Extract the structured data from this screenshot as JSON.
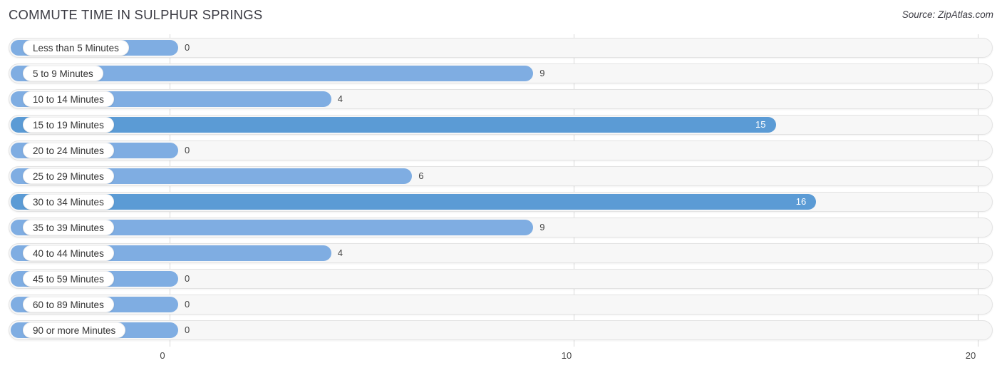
{
  "header": {
    "title": "COMMUTE TIME IN SULPHUR SPRINGS",
    "source": "Source: ZipAtlas.com"
  },
  "colors": {
    "bar_light": "#7fadE2",
    "bar_dark": "#5b9bd5",
    "track_bg": "#f7f7f7",
    "track_border": "#e3e3e3",
    "gridline": "#d8d8d8",
    "text": "#333333",
    "value_inside": "#ffffff"
  },
  "chart_data": {
    "type": "bar",
    "orientation": "horizontal",
    "title": "COMMUTE TIME IN SULPHUR SPRINGS",
    "xlabel": "",
    "ylabel": "",
    "xlim": [
      0,
      20
    ],
    "xticks": [
      0,
      10,
      20
    ],
    "xtick_labels": [
      "0",
      "10",
      "20"
    ],
    "grid": true,
    "legend": false,
    "categories": [
      "Less than 5 Minutes",
      "5 to 9 Minutes",
      "10 to 14 Minutes",
      "15 to 19 Minutes",
      "20 to 24 Minutes",
      "25 to 29 Minutes",
      "30 to 34 Minutes",
      "35 to 39 Minutes",
      "40 to 44 Minutes",
      "45 to 59 Minutes",
      "60 to 89 Minutes",
      "90 or more Minutes"
    ],
    "values": [
      0,
      9,
      4,
      15,
      0,
      6,
      16,
      9,
      4,
      0,
      0,
      0
    ],
    "value_labels": [
      "0",
      "9",
      "4",
      "15",
      "0",
      "6",
      "16",
      "9",
      "4",
      "0",
      "0",
      "0"
    ]
  },
  "rows": [
    {
      "label": "Less than 5 Minutes",
      "value": 0,
      "value_label": "0",
      "shade": "light",
      "label_inside": false
    },
    {
      "label": "5 to 9 Minutes",
      "value": 9,
      "value_label": "9",
      "shade": "light",
      "label_inside": false
    },
    {
      "label": "10 to 14 Minutes",
      "value": 4,
      "value_label": "4",
      "shade": "light",
      "label_inside": false
    },
    {
      "label": "15 to 19 Minutes",
      "value": 15,
      "value_label": "15",
      "shade": "dark",
      "label_inside": true
    },
    {
      "label": "20 to 24 Minutes",
      "value": 0,
      "value_label": "0",
      "shade": "light",
      "label_inside": false
    },
    {
      "label": "25 to 29 Minutes",
      "value": 6,
      "value_label": "6",
      "shade": "light",
      "label_inside": false
    },
    {
      "label": "30 to 34 Minutes",
      "value": 16,
      "value_label": "16",
      "shade": "dark",
      "label_inside": true
    },
    {
      "label": "35 to 39 Minutes",
      "value": 9,
      "value_label": "9",
      "shade": "light",
      "label_inside": false
    },
    {
      "label": "40 to 44 Minutes",
      "value": 4,
      "value_label": "4",
      "shade": "light",
      "label_inside": false
    },
    {
      "label": "45 to 59 Minutes",
      "value": 0,
      "value_label": "0",
      "shade": "light",
      "label_inside": false
    },
    {
      "label": "60 to 89 Minutes",
      "value": 0,
      "value_label": "0",
      "shade": "light",
      "label_inside": false
    },
    {
      "label": "90 or more Minutes",
      "value": 0,
      "value_label": "0",
      "shade": "light",
      "label_inside": false
    }
  ],
  "axis": {
    "ticks": [
      "0",
      "10",
      "20"
    ]
  }
}
